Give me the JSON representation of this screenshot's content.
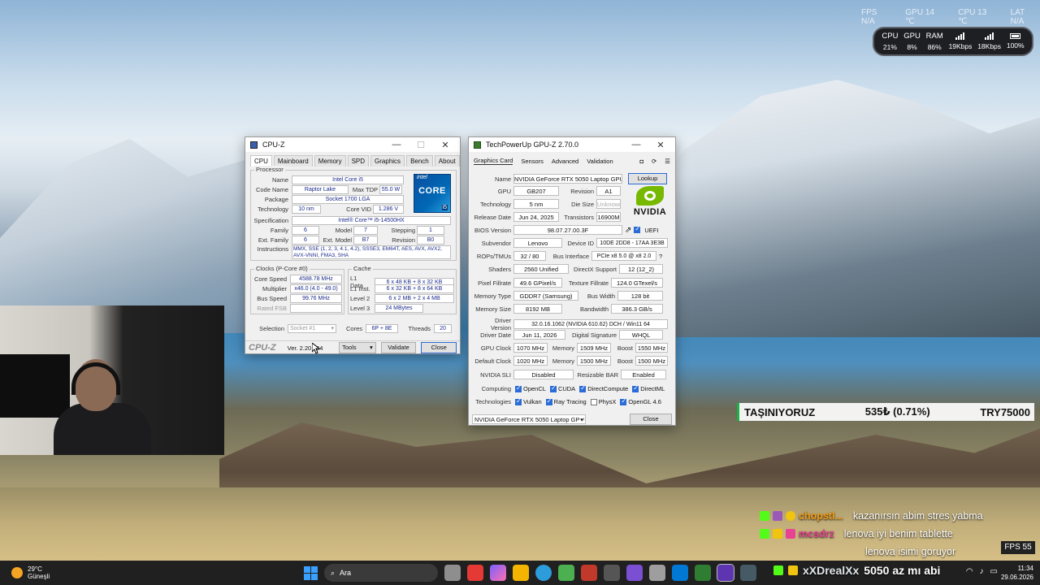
{
  "overlay": {
    "top_faint": [
      "FPS N/A",
      "GPU 14 ℃",
      "CPU 13 ℃",
      "LAT N/A"
    ],
    "perf": [
      {
        "label": "CPU",
        "value": "21%"
      },
      {
        "label": "GPU",
        "value": "8%"
      },
      {
        "label": "RAM",
        "value": "86%"
      },
      {
        "label": "",
        "value": "19Kbps"
      },
      {
        "label": "",
        "value": "18Kbps"
      },
      {
        "label": "",
        "value": "100%"
      }
    ],
    "ticker": {
      "title": "TAŞINIYORUZ",
      "value": "535₺ (0.71%)",
      "goal": "TRY75000"
    },
    "chat": [
      {
        "user": "chopstI...",
        "message": "kazanırsın abim stres yabma"
      },
      {
        "user": "mcsdrz",
        "message": "lenova iyi benim tablette"
      },
      {
        "user": "",
        "message": "lenova isimi goruyor"
      }
    ],
    "fps_box": "FPS 55",
    "stream_user": "xXDrealXx",
    "stream_text": "5050 az mı abi"
  },
  "cpuz": {
    "title": "CPU-Z",
    "tabs": [
      "CPU",
      "Mainboard",
      "Memory",
      "SPD",
      "Graphics",
      "Bench",
      "About"
    ],
    "processor_label": "Processor",
    "name_k": "Name",
    "name_v": "Intel Core i5",
    "codename_k": "Code Name",
    "codename_v": "Raptor Lake",
    "maxtdp_k": "Max TDP",
    "maxtdp_v": "55.0 W",
    "package_k": "Package",
    "package_v": "Socket 1700 LGA",
    "tech_k": "Technology",
    "tech_v": "10 nm",
    "vid_k": "Core VID",
    "vid_v": "1.286 V",
    "spec_k": "Specification",
    "spec_v": "Intel® Core™ i5-14500HX",
    "family_k": "Family",
    "family_v": "6",
    "model_k": "Model",
    "model_v": "7",
    "stepping_k": "Stepping",
    "stepping_v": "1",
    "extfam_k": "Ext. Family",
    "extfam_v": "6",
    "extmodel_k": "Ext. Model",
    "extmodel_v": "B7",
    "revision_k": "Revision",
    "revision_v": "B0",
    "instr_k": "Instructions",
    "instr_v": "MMX, SSE (1, 2, 3, 4.1, 4.2), SSSE3, EM64T, AES, AVX, AVX2, AVX-VNNI, FMA3, SHA",
    "clocks_label": "Clocks (P-Core #0)",
    "corespeed_k": "Core Speed",
    "corespeed_v": "4588.78 MHz",
    "mult_k": "Multiplier",
    "mult_v": "x46.0 (4.0 - 49.0)",
    "bus_k": "Bus Speed",
    "bus_v": "99.76 MHz",
    "fsb_k": "Rated FSB",
    "cache_label": "Cache",
    "l1d_k": "L1 Data",
    "l1d_v": "6 x 48 KB + 8 x 32 KB",
    "l1i_k": "L1 Inst.",
    "l1i_v": "6 x 32 KB + 8 x 64 KB",
    "l2_k": "Level 2",
    "l2_v": "6 x 2 MB + 2 x 4 MB",
    "l3_k": "Level 3",
    "l3_v": "24 MBytes",
    "selection_k": "Selection",
    "selection_v": "Socket #1",
    "cores_k": "Cores",
    "cores_v": "6P + 8E",
    "threads_k": "Threads",
    "threads_v": "20",
    "brand": "CPU-Z",
    "version": "Ver. 2.20 x64",
    "tools_btn": "Tools",
    "validate_btn": "Validate",
    "close_btn": "Close",
    "logo_brand": "intel",
    "logo_core": "CORE",
    "logo_tier": "i5"
  },
  "gpuz": {
    "title": "TechPowerUp GPU-Z 2.70.0",
    "tabs": [
      "Graphics Card",
      "Sensors",
      "Advanced",
      "Validation"
    ],
    "name_k": "Name",
    "name_v": "NVIDIA GeForce RTX 5050 Laptop GPU",
    "lookup_btn": "Lookup",
    "gpu_k": "GPU",
    "gpu_v": "GB207",
    "rev_k": "Revision",
    "rev_v": "A1",
    "tech_k": "Technology",
    "tech_v": "5 nm",
    "die_k": "Die Size",
    "die_v": "Unknown",
    "release_k": "Release Date",
    "release_v": "Jun 24, 2025",
    "trans_k": "Transistors",
    "trans_v": "16900M",
    "bios_k": "BIOS Version",
    "bios_v": "98.07.27.00.3F",
    "uefi": "UEFI",
    "subvendor_k": "Subvendor",
    "subvendor_v": "Lenovo",
    "devid_k": "Device ID",
    "devid_v": "10DE 2DD8 - 17AA 3E3B",
    "rops_k": "ROPs/TMUs",
    "rops_v": "32 / 80",
    "busif_k": "Bus Interface",
    "busif_v": "PCIe x8 5.0 @ x8 2.0",
    "shaders_k": "Shaders",
    "shaders_v": "2560 Unified",
    "dx_k": "DirectX Support",
    "dx_v": "12 (12_2)",
    "pixel_k": "Pixel Fillrate",
    "pixel_v": "49.6 GPixel/s",
    "texture_k": "Texture Fillrate",
    "texture_v": "124.0 GTexel/s",
    "memtype_k": "Memory Type",
    "memtype_v": "GDDR7 (Samsung)",
    "buswidth_k": "Bus Width",
    "buswidth_v": "128 bit",
    "memsize_k": "Memory Size",
    "memsize_v": "8192 MB",
    "bandwidth_k": "Bandwidth",
    "bandwidth_v": "386.3 GB/s",
    "driver_k": "Driver Version",
    "driver_v": "32.0.16.1062 (NVIDIA 610.62) DCH / Win11 64",
    "driverdate_k": "Driver Date",
    "driverdate_v": "Jun 11, 2026",
    "sig_k": "Digital Signature",
    "sig_v": "WHQL",
    "gpuclock_k": "GPU Clock",
    "gpuclock_v": "1070 MHz",
    "mem_k": "Memory",
    "mem_v": "1509 MHz",
    "boost_k": "Boost",
    "boost_v": "1550 MHz",
    "defclock_k": "Default Clock",
    "defclock_v": "1020 MHz",
    "defmem_v": "1500 MHz",
    "defboost_v": "1500 MHz",
    "sli_k": "NVIDIA SLI",
    "sli_v": "Disabled",
    "rebar_k": "Resizable BAR",
    "rebar_v": "Enabled",
    "computing_k": "Computing",
    "computing": [
      "OpenCL",
      "CUDA",
      "DirectCompute",
      "DirectML"
    ],
    "technologies_k": "Technologies",
    "technologies": [
      "Vulkan",
      "Ray Tracing",
      "PhysX",
      "OpenGL 4.6"
    ],
    "select_v": "NVIDIA GeForce RTX 5050 Laptop GPU",
    "close_btn": "Close",
    "logo_text": "NVIDIA"
  },
  "taskbar": {
    "temp": "29°C",
    "city": "Güneşli",
    "search": "Ara",
    "time": "11:34",
    "date": "29.06.2026"
  },
  "colors": {
    "accent": "#2b6bd6",
    "nvidia_green": "#76b900",
    "intel_blue": "#0068b5",
    "ticker_green": "#19b34a"
  }
}
